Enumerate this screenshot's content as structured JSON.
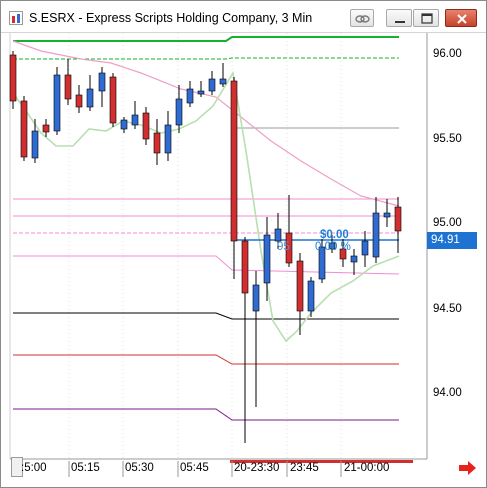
{
  "window": {
    "title": "S.ESRX - Express Scripts Holding Company, 3 Min",
    "icons": [
      "chart-icon",
      "link-icon",
      "minimize-icon",
      "maximize-icon",
      "close-icon"
    ]
  },
  "chart_data": {
    "type": "candlestick",
    "y_axis_labels": [
      "96.00",
      "95.50",
      "95.00",
      "94.50",
      "94.00"
    ],
    "current_price": "94.91",
    "time_labels": [
      ":5:00",
      "05:15",
      "05:30",
      "05:45",
      "20-23:30",
      "23:45",
      "21-00:00"
    ],
    "position_pnl": "$0.00",
    "position_pct": "0.00 %",
    "position_partial": "95",
    "colors": {
      "up": "#2f6bd1",
      "down": "#d12f2f",
      "price_marker": "#1e73d2",
      "pnl_text": "#1e7ed6",
      "level_green": "#16b22d",
      "level_pink": "#f08cd6",
      "level_red": "#d12f2f",
      "level_purple": "#7a1a8a",
      "level_black": "#000000",
      "avg_pink": "#ef9ec7",
      "avg_green": "#b7dfb0"
    }
  }
}
